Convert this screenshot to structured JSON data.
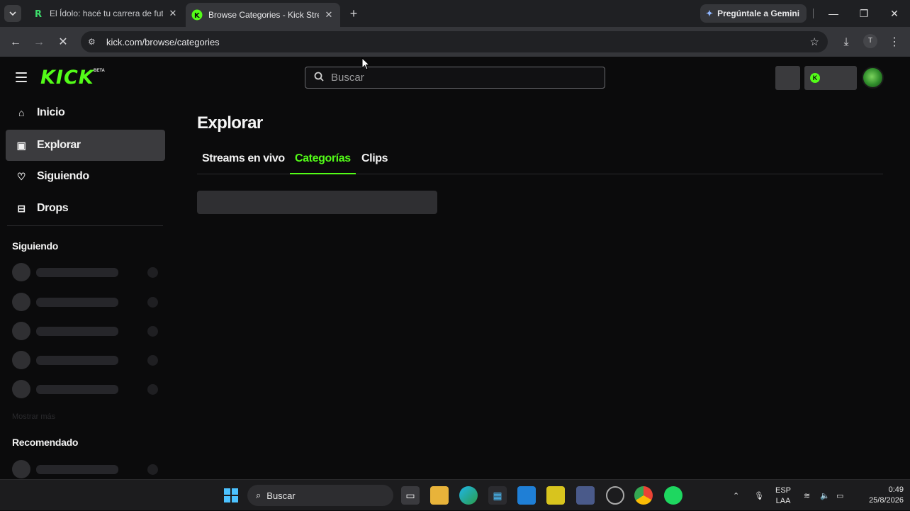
{
  "browser": {
    "tabs": [
      {
        "title": "El Ídolo: hacé tu carrera de futb",
        "active": false,
        "favicon": "r-logo-icon"
      },
      {
        "title": "Browse Categories - Kick Stream",
        "active": true,
        "favicon": "kick-logo-icon"
      }
    ],
    "gemini_label": "Pregúntale a Gemini",
    "url": "kick.com/browse/categories",
    "profile_initial": "T"
  },
  "kick": {
    "logo_text": "KICK",
    "logo_badge": "BETA",
    "search_placeholder": "Buscar",
    "sidebar": {
      "items": [
        {
          "label": "Inicio",
          "icon": "home-icon"
        },
        {
          "label": "Explorar",
          "icon": "browse-icon",
          "active": true
        },
        {
          "label": "Siguiendo",
          "icon": "heart-icon"
        },
        {
          "label": "Drops",
          "icon": "drops-icon"
        }
      ],
      "following_header": "Siguiendo",
      "show_more": "Mostrar más",
      "recommended_header": "Recomendado"
    },
    "page_title": "Explorar",
    "tabs": [
      {
        "label": "Streams en vivo",
        "active": false
      },
      {
        "label": "Categorías",
        "active": true
      },
      {
        "label": "Clips",
        "active": false
      }
    ],
    "accent": "#53fc18"
  },
  "taskbar": {
    "search_label": "Buscar",
    "lang_top": "ESP",
    "lang_bottom": "LAA",
    "time": "0:49",
    "date": "25/8/2026"
  }
}
